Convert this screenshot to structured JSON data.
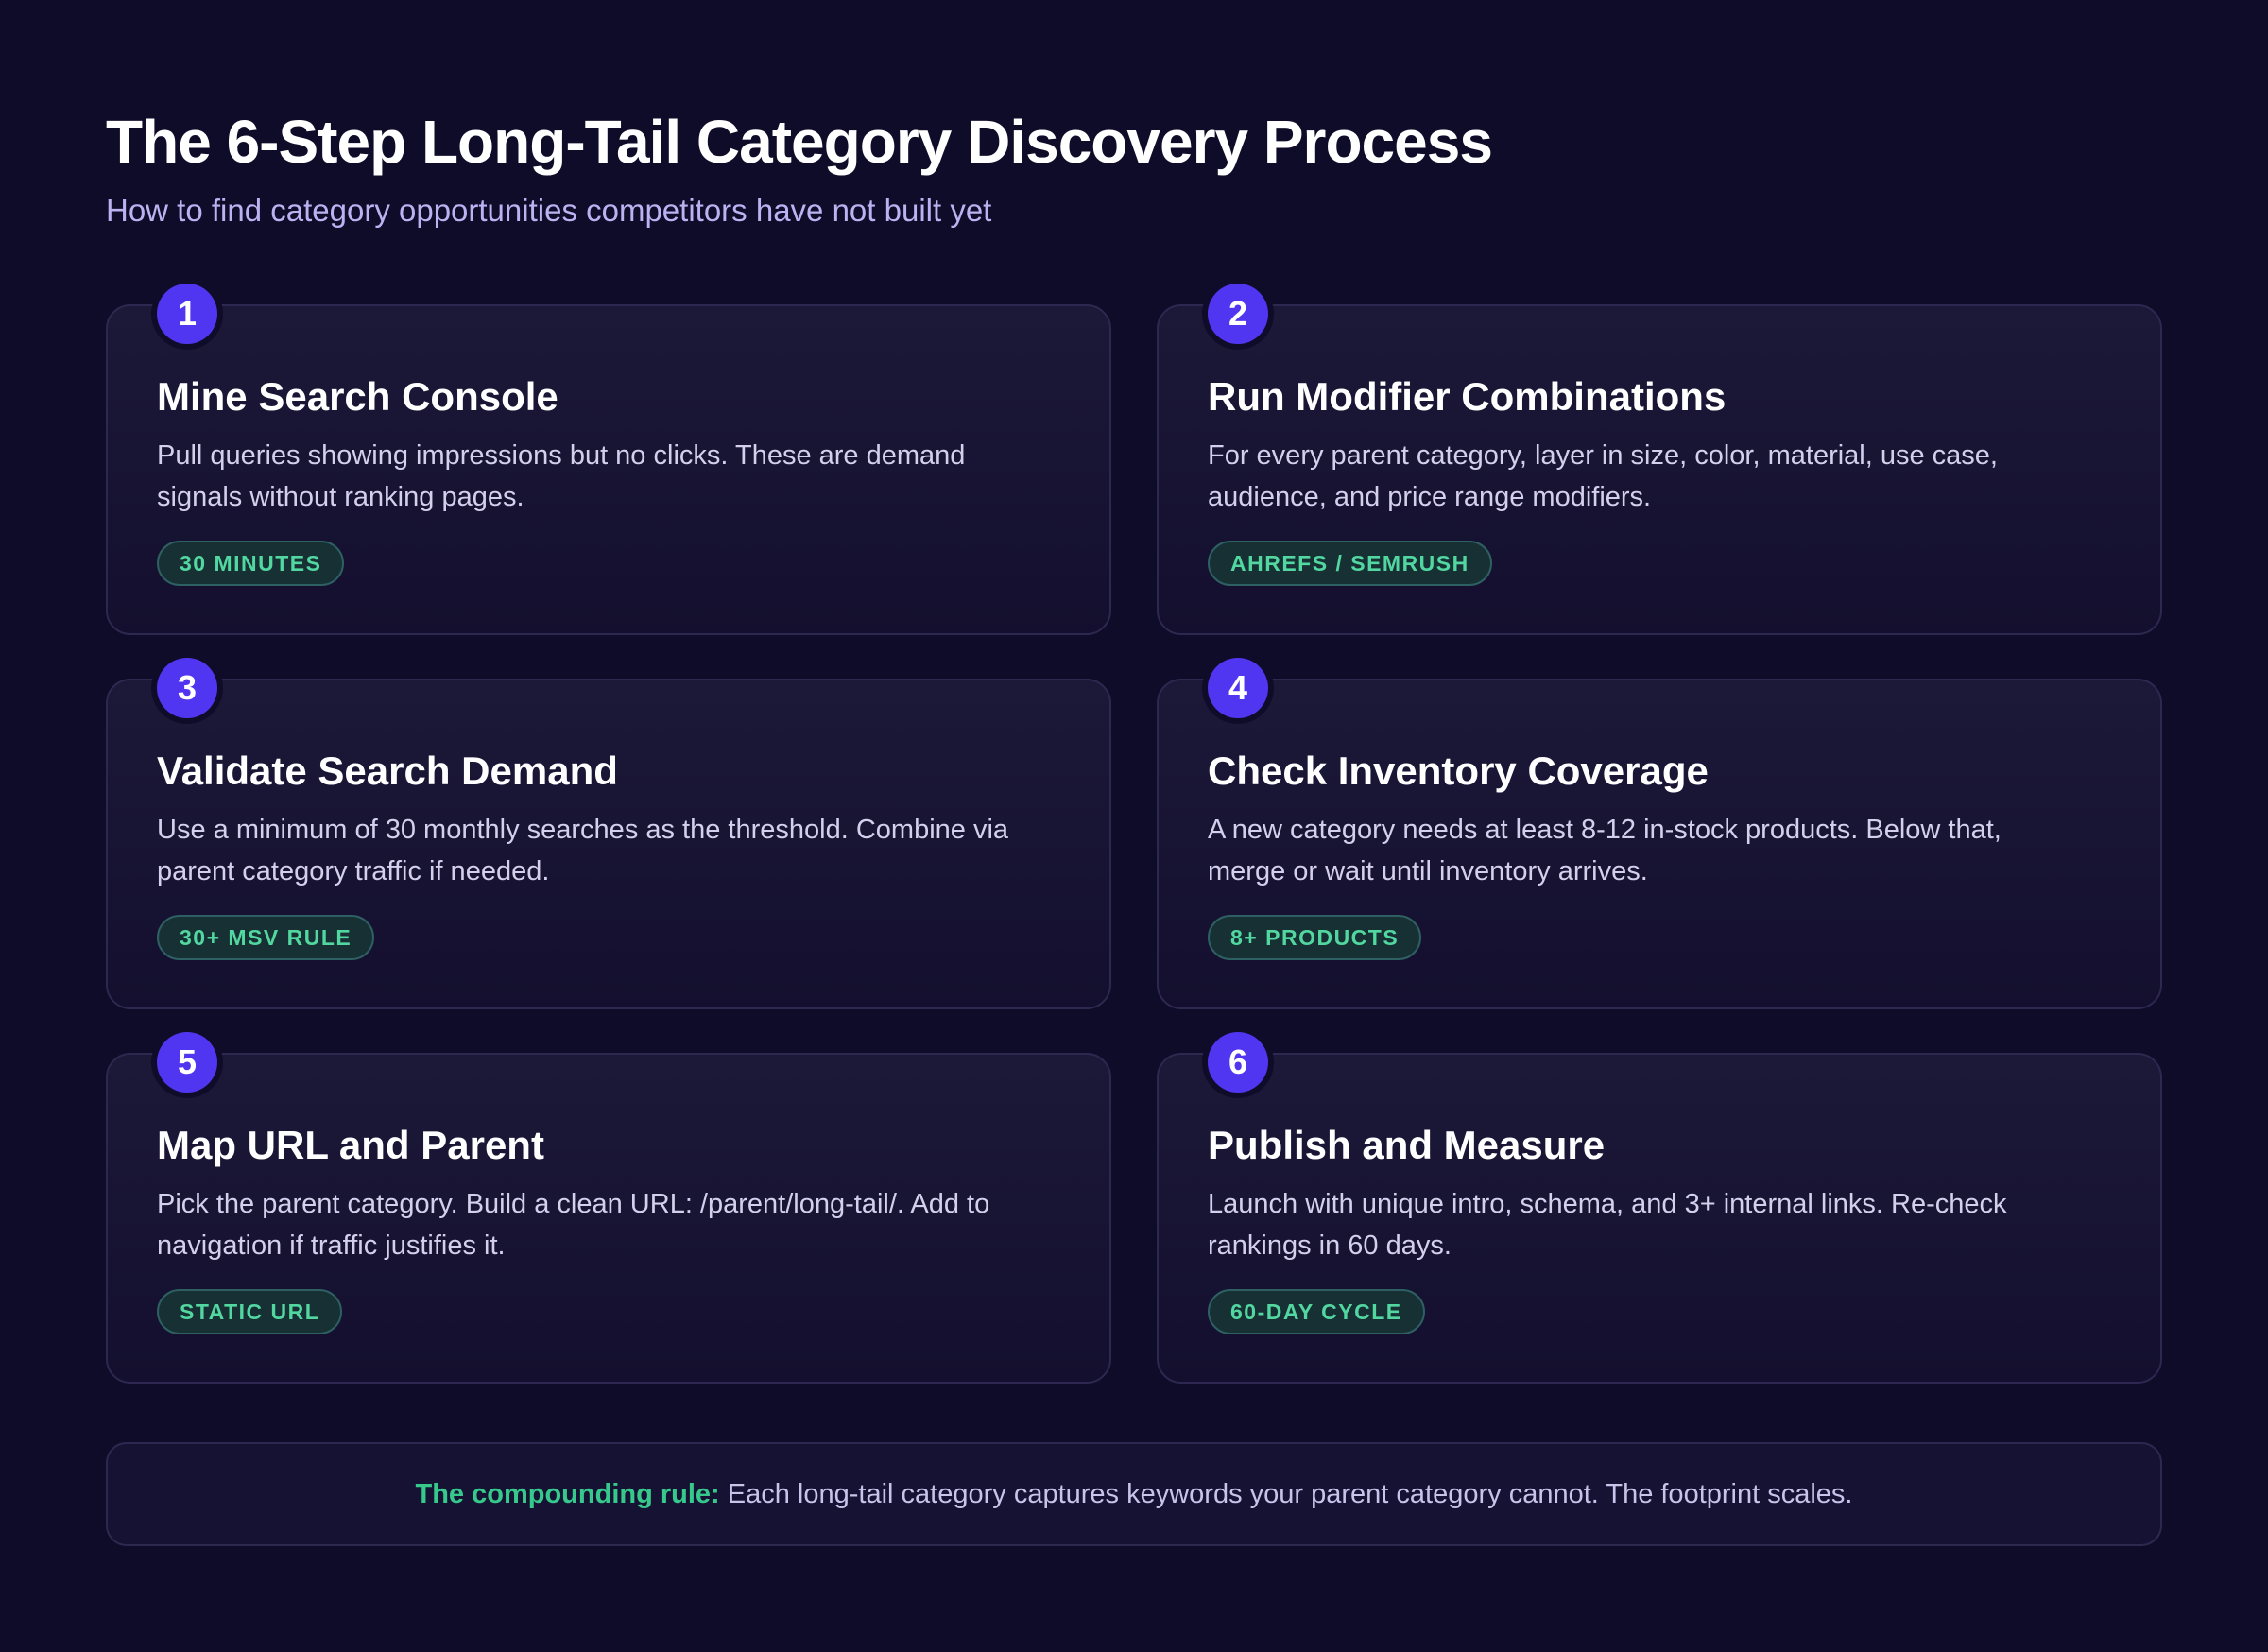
{
  "header": {
    "title": "The 6-Step Long-Tail Category Discovery Process",
    "subtitle": "How to find category opportunities competitors have not built yet"
  },
  "steps": [
    {
      "number": "1",
      "title": "Mine Search Console",
      "description": "Pull queries showing impressions but no clicks. These are demand signals without ranking pages.",
      "tag": "30 MINUTES"
    },
    {
      "number": "2",
      "title": "Run Modifier Combinations",
      "description": "For every parent category, layer in size, color, material, use case, audience, and price range modifiers.",
      "tag": "AHREFS / SEMRUSH"
    },
    {
      "number": "3",
      "title": "Validate Search Demand",
      "description": "Use a minimum of 30 monthly searches as the threshold. Combine via parent category traffic if needed.",
      "tag": "30+ MSV RULE"
    },
    {
      "number": "4",
      "title": "Check Inventory Coverage",
      "description": "A new category needs at least 8-12 in-stock products. Below that, merge or wait until inventory arrives.",
      "tag": "8+ PRODUCTS"
    },
    {
      "number": "5",
      "title": "Map URL and Parent",
      "description": "Pick the parent category. Build a clean URL: /parent/long-tail/. Add to navigation if traffic justifies it.",
      "tag": "STATIC URL"
    },
    {
      "number": "6",
      "title": "Publish and Measure",
      "description": "Launch with unique intro, schema, and 3+ internal links. Re-check rankings in 60 days.",
      "tag": "60-DAY CYCLE"
    }
  ],
  "footer": {
    "label": "The compounding rule:",
    "text": "Each long-tail category captures keywords your parent category cannot. The footprint scales."
  },
  "colors": {
    "background": "#0f0c29",
    "accent": "#5036f0",
    "tag_text": "#52d7a0",
    "rule_label": "#36c98b"
  }
}
